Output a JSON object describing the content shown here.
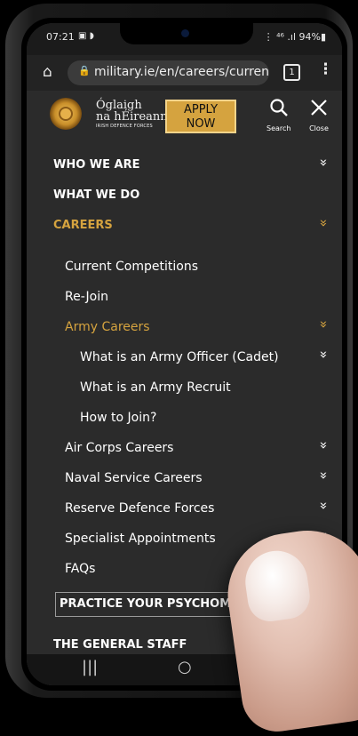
{
  "status": {
    "time": "07:21",
    "icons": "▣ ◗",
    "right": "⋮ ⁴⁶ .ıl 94%▮"
  },
  "browser": {
    "home_icon": "⌂",
    "lock_icon": "🔒",
    "url": "military.ie/en/careers/curren",
    "tab_count": "1",
    "menu_icon": "⋮"
  },
  "header": {
    "logo_line1": "Óglaigh",
    "logo_line2": "na hÉireann",
    "logo_line3": "IRISH DEFENCE FORCES",
    "apply_label": "APPLY\nNOW",
    "apply_l1": "APPLY",
    "apply_l2": "NOW",
    "search_label": "Search",
    "close_label": "Close",
    "accent": "#d5a33f"
  },
  "menu": {
    "items": [
      {
        "label": "WHO WE ARE"
      },
      {
        "label": "WHAT WE DO"
      },
      {
        "label": "CAREERS"
      },
      {
        "label": "Current Competitions"
      },
      {
        "label": "Re-Join"
      },
      {
        "label": "Army Careers"
      },
      {
        "label": "What is an Army Officer (Cadet)"
      },
      {
        "label": "What is an Army Recruit"
      },
      {
        "label": "How to Join?"
      },
      {
        "label": "Air Corps Careers"
      },
      {
        "label": "Naval Service Careers"
      },
      {
        "label": "Reserve Defence Forces"
      },
      {
        "label": "Specialist Appointments"
      },
      {
        "label": "FAQs"
      },
      {
        "label": "PRACTICE YOUR PSYCHOMETRIC"
      },
      {
        "label": "THE GENERAL STAFF"
      }
    ],
    "chevron": "»"
  },
  "nav": {
    "recents": "|||",
    "home": "○",
    "back": "<"
  }
}
